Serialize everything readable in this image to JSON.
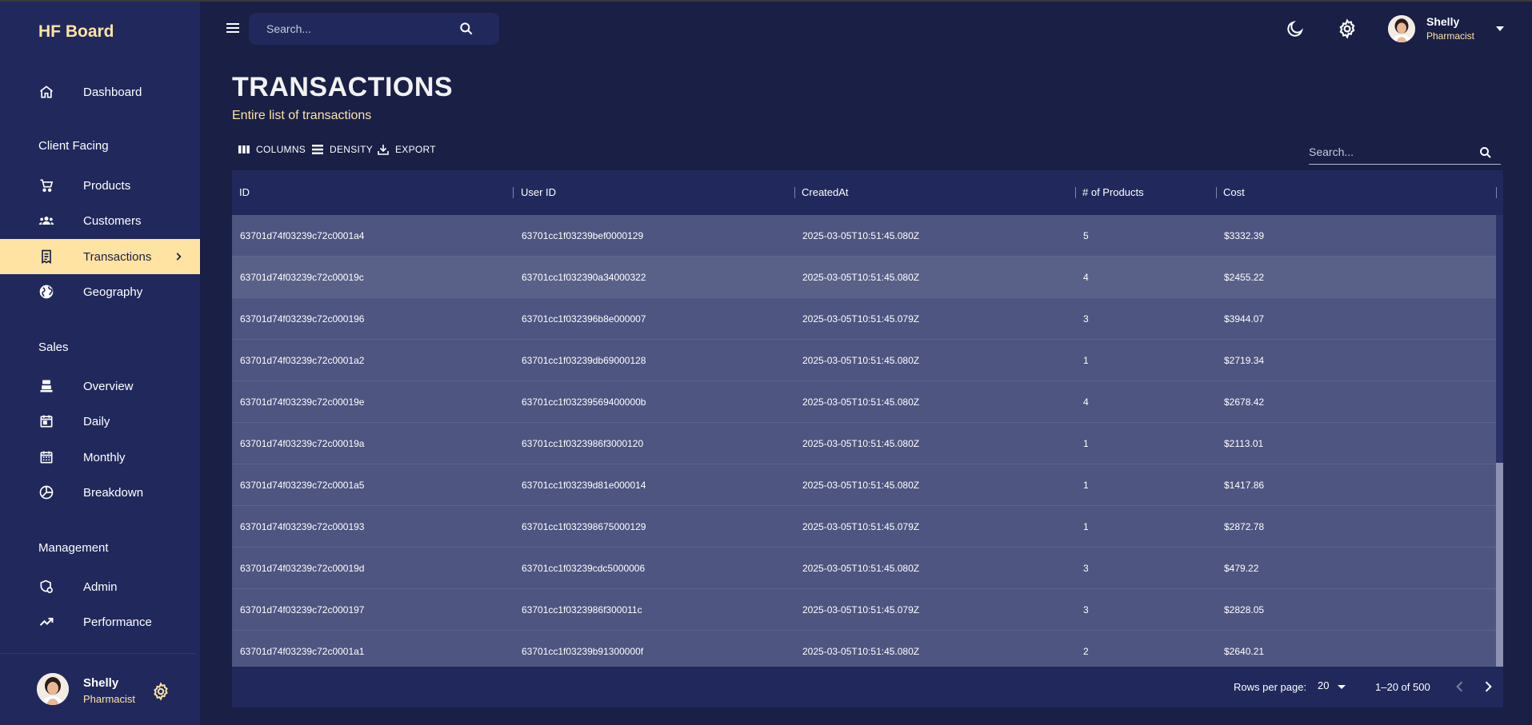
{
  "brand": "HF Board",
  "sidebar": {
    "dashboard": "Dashboard",
    "sections": {
      "client": "Client Facing",
      "sales": "Sales",
      "management": "Management"
    },
    "client_items": [
      "Products",
      "Customers",
      "Transactions",
      "Geography"
    ],
    "sales_items": [
      "Overview",
      "Daily",
      "Monthly",
      "Breakdown"
    ],
    "management_items": [
      "Admin",
      "Performance"
    ],
    "active_item": "Transactions",
    "user": {
      "name": "Shelly",
      "role": "Pharmacist"
    }
  },
  "topbar": {
    "search_placeholder": "Search...",
    "user": {
      "name": "Shelly",
      "role": "Pharmacist"
    }
  },
  "header": {
    "title": "TRANSACTIONS",
    "subtitle": "Entire list of transactions"
  },
  "toolbar": {
    "columns": "COLUMNS",
    "density": "DENSITY",
    "export": "EXPORT",
    "search_placeholder": "Search..."
  },
  "table": {
    "columns": [
      "ID",
      "User ID",
      "CreatedAt",
      "# of Products",
      "Cost"
    ],
    "rows": [
      [
        "63701d74f03239c72c0001a4",
        "63701cc1f03239bef0000129",
        "2025-03-05T10:51:45.080Z",
        "5",
        "$3332.39"
      ],
      [
        "63701d74f03239c72c00019c",
        "63701cc1f032390a34000322",
        "2025-03-05T10:51:45.080Z",
        "4",
        "$2455.22"
      ],
      [
        "63701d74f03239c72c000196",
        "63701cc1f032396b8e000007",
        "2025-03-05T10:51:45.079Z",
        "3",
        "$3944.07"
      ],
      [
        "63701d74f03239c72c0001a2",
        "63701cc1f03239db69000128",
        "2025-03-05T10:51:45.080Z",
        "1",
        "$2719.34"
      ],
      [
        "63701d74f03239c72c00019e",
        "63701cc1f03239569400000b",
        "2025-03-05T10:51:45.080Z",
        "4",
        "$2678.42"
      ],
      [
        "63701d74f03239c72c00019a",
        "63701cc1f0323986f3000120",
        "2025-03-05T10:51:45.080Z",
        "1",
        "$2113.01"
      ],
      [
        "63701d74f03239c72c0001a5",
        "63701cc1f03239d81e000014",
        "2025-03-05T10:51:45.080Z",
        "1",
        "$1417.86"
      ],
      [
        "63701d74f03239c72c000193",
        "63701cc1f032398675000129",
        "2025-03-05T10:51:45.079Z",
        "1",
        "$2872.78"
      ],
      [
        "63701d74f03239c72c00019d",
        "63701cc1f03239cdc5000006",
        "2025-03-05T10:51:45.080Z",
        "3",
        "$479.22"
      ],
      [
        "63701d74f03239c72c000197",
        "63701cc1f0323986f300011c",
        "2025-03-05T10:51:45.079Z",
        "3",
        "$2828.05"
      ],
      [
        "63701d74f03239c72c0001a1",
        "63701cc1f03239b91300000f",
        "2025-03-05T10:51:45.080Z",
        "2",
        "$2640.21"
      ]
    ],
    "footer": {
      "rows_per_page_label": "Rows per page:",
      "rows_per_page": "20",
      "range": "1–20 of 500"
    }
  },
  "colors": {
    "background": "#191f45",
    "panel": "#21295c",
    "accent": "#ffe3a3",
    "row": "#4e5580"
  }
}
